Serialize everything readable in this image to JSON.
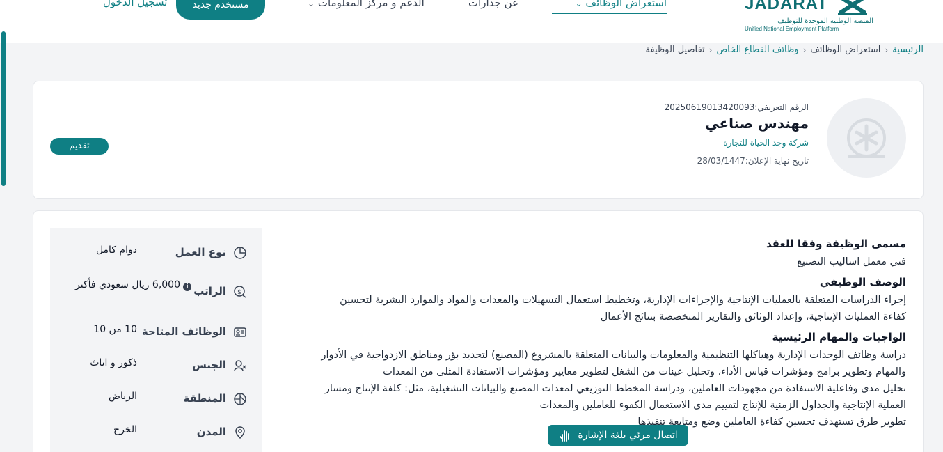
{
  "header": {
    "logo_word": "JADARAT",
    "logo_ar": "المنصة الوطنية الموحدة للتوظيف",
    "logo_en": "Unified National Employment Platform",
    "nav": [
      {
        "label": "استعراض الوظائف",
        "active": true
      },
      {
        "label": "عن جدارات",
        "active": false
      },
      {
        "label": "الدعم و مركز المعلومات",
        "active": false
      }
    ],
    "new_user_label": "مستخدم جديد",
    "login_label": "تسجيل الدخول"
  },
  "breadcrumb": {
    "home": "الرئيسية",
    "browse": "استعراض الوظائف",
    "private": "وظائف القطاع الخاص",
    "current": "تفاصيل الوظيفة"
  },
  "job": {
    "ref": "الرقم التعريفي:20250619013420093",
    "title": "مهندس صناعي",
    "company": "شركة وجد الحياة للتجارة",
    "deadline": "تاريخ نهاية الإعلان:28/03/1447",
    "apply_label": "تقديم"
  },
  "details": [
    {
      "label": "نوع العمل",
      "value": "دوام كامل",
      "icon": "pie-chart-icon"
    },
    {
      "label": "الراتب",
      "value": "6,000 ريال سعودي فأكتر",
      "icon": "money-icon"
    },
    {
      "label": "الوظائف المتاحة",
      "value": "10  من 10",
      "icon": "id-card-icon"
    },
    {
      "label": "الجنس",
      "value": "ذكور و اناث",
      "icon": "gender-icon"
    },
    {
      "label": "المنطقة",
      "value": "الرياض",
      "icon": "map-icon"
    },
    {
      "label": "المدن",
      "value": "الخرج",
      "icon": "location-pin-icon"
    }
  ],
  "content": {
    "contract_title_heading": "مسمى الوظيفة وفقا للعقد",
    "contract_title": "فني معمل اساليب التصنيع",
    "desc_heading": "الوصف الوظيفي",
    "desc_1": "إجراء الدراسات المتعلقة بالعمليات الإنتاجية والإجراءات الإدارية، وتخطيط استعمال التسهيلات والمعدات والمواد والموارد البشرية لتحسين",
    "desc_2": "كفاءة العمليات الإنتاجية، وإعداد الوثائق والتقارير المتخصصة بنتائج الأعمال",
    "duties_heading": "الواجبات والمهام الرئيسية",
    "duty_1": "دراسة وظائف الوحدات الإدارية وهياكلها التنظيمية والمعلومات والبيانات المتعلقة بالمشروع (المصنع) لتحديد بؤر ومناطق الازدواجية في الأدوار",
    "duty_2": "والمهام وتطوير برامج ومؤشرات قياس الأداء، وتحليل عينات من الشغل لتطوير معايير ومؤشرات الاستفادة المثلى من المعدات",
    "duty_3": "تحليل مدى وفاعلية الاستفادة من مجهودات العاملين، ودراسة المخطط التوزيعي لمعدات المصنع والبيانات التشغيلية، مثل: كلفة الإنتاج ومسار",
    "duty_4": "العملية الإنتاجية والجداول الزمنية للإنتاج لتقييم مدى الاستعمال الكفوء للعاملين والمعدات",
    "duty_5": "تطوير طرق تستهدف تحسين كفاءة العاملين وضع ومتابعة تنفيذها"
  },
  "sign_language_label": "اتصال مرئي بلغة الإشارة",
  "colors": {
    "brand": "#0f7f84"
  }
}
